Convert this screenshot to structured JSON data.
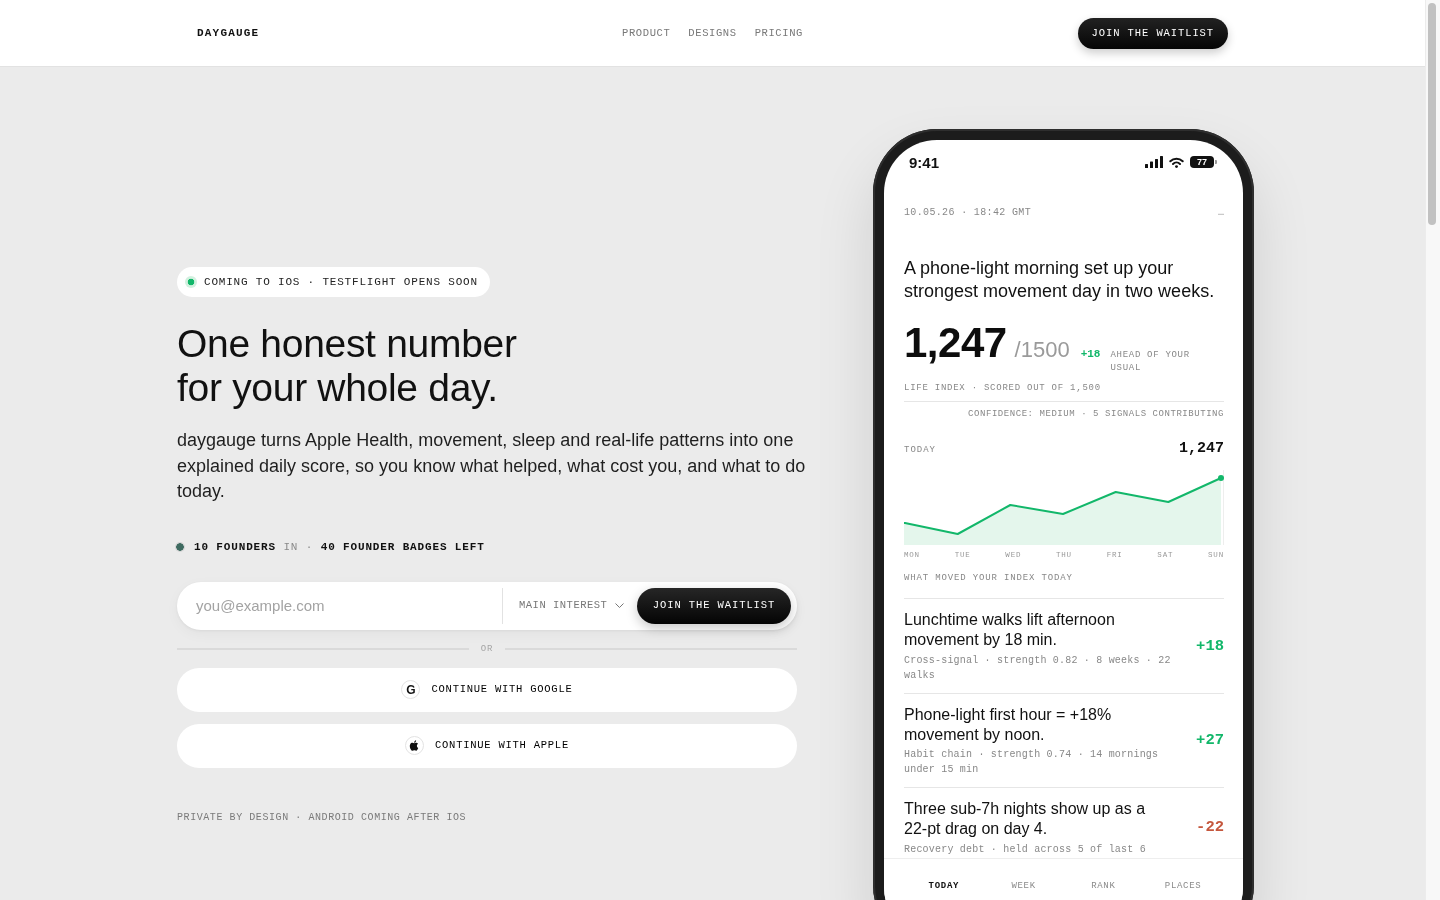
{
  "header": {
    "logo": "DAYGAUGE",
    "nav": [
      "PRODUCT",
      "DESIGNS",
      "PRICING"
    ],
    "cta": "JOIN THE WAITLIST"
  },
  "hero": {
    "badge": "COMING TO IOS · TESTFLIGHT OPENS SOON",
    "title_lines": [
      "One honest number",
      "for your whole day."
    ],
    "description": "daygauge turns Apple Health, movement, sleep and real-life patterns into one explained daily score, so you know what helped, what cost you, and what to do today.",
    "founders": "**10 FOUNDERS** IN · **40 FOUNDER BADGES LEFT**",
    "signup": {
      "email": {
        "placeholder": "you@example.com"
      },
      "interest": {
        "label": "MAIN INTEREST"
      },
      "submit": "JOIN THE WAITLIST"
    },
    "divider": "OR",
    "social_buttons": [
      {
        "kind": "google",
        "glyph": "G",
        "label": "CONTINUE WITH GOOGLE"
      },
      {
        "kind": "apple",
        "label": "CONTINUE WITH APPLE"
      }
    ],
    "footnote": "PRIVATE BY DESIGN · ANDROID COMING AFTER IOS"
  },
  "phone": {
    "status_bar": {
      "time": "9:41",
      "battery": "77"
    },
    "timestamp": "10.05.26 · 18:42 GMT",
    "menu_glyph": "…",
    "headline": "A phone-light morning set up your strongest movement day in two weeks.",
    "score": {
      "value": "1,247",
      "max": "/1500",
      "delta": "+18",
      "delta_note": "AHEAD OF YOUR USUAL",
      "caption": "LIFE INDEX · SCORED OUT OF 1,500",
      "confidence": "CONFIDENCE: MEDIUM · 5 SIGNALS CONTRIBUTING"
    },
    "trend": {
      "label": "TODAY",
      "value": "1,247",
      "days": [
        "MON",
        "TUE",
        "WED",
        "THU",
        "FRI",
        "SAT",
        "SUN"
      ]
    },
    "insights_heading": "WHAT MOVED YOUR INDEX TODAY",
    "insights": [
      {
        "title": "Lunchtime walks lift afternoon movement by 18 min.",
        "meta": "Cross-signal · strength 0.82 · 8 weeks · 22 walks",
        "delta": "+18",
        "color": "#12b76a"
      },
      {
        "title": "Phone-light first hour = +18% movement by noon.",
        "meta": "Habit chain · strength 0.74 · 14 mornings under 15 min",
        "delta": "+27",
        "color": "#12b76a"
      },
      {
        "title": "Three sub-7h nights show up as a 22-pt drag on day 4.",
        "meta": "Recovery debt · held across 5 of last 6",
        "delta": "-22",
        "color": "#c5573d"
      }
    ],
    "tabs": [
      {
        "label": "TODAY",
        "selected": true
      },
      {
        "label": "WEEK",
        "selected": false
      },
      {
        "label": "RANK",
        "selected": false
      },
      {
        "label": "PLACES",
        "selected": false
      }
    ]
  }
}
